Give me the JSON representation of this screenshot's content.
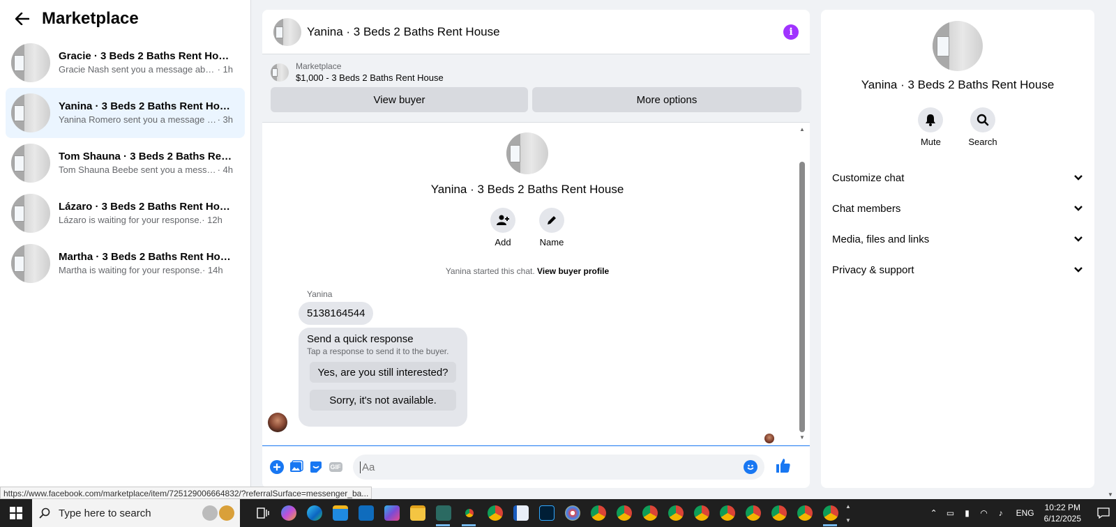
{
  "sidebar": {
    "title": "Marketplace",
    "conversations": [
      {
        "name": "Gracie · 3 Beds 2 Baths Rent House",
        "snippet": "Gracie Nash sent you a message abou...",
        "time": "· 1h",
        "active": false
      },
      {
        "name": "Yanina · 3 Beds 2 Baths Rent House",
        "snippet": "Yanina Romero sent you a message a...",
        "time": "· 3h",
        "active": true
      },
      {
        "name": "Tom Shauna · 3 Beds 2 Baths Rent ...",
        "snippet": "Tom Shauna Beebe sent you a messag...",
        "time": "· 4h",
        "active": false
      },
      {
        "name": "Lázaro · 3 Beds 2 Baths Rent House",
        "snippet": "Lázaro is waiting for your response.",
        "time": "· 12h",
        "active": false
      },
      {
        "name": "Martha · 3 Beds 2 Baths Rent House",
        "snippet": "Martha is waiting for your response.",
        "time": "· 14h",
        "active": false
      }
    ]
  },
  "chat": {
    "title": "Yanina · 3 Beds 2 Baths Rent House",
    "listing": {
      "label": "Marketplace",
      "price_title": "$1,000 - 3 Beds 2 Baths Rent House"
    },
    "view_buyer": "View buyer",
    "more_options": "More options",
    "profile_name": "Yanina · 3 Beds 2 Baths Rent House",
    "actions": {
      "add": "Add",
      "name": "Name"
    },
    "started_text": "Yanina started this chat.",
    "view_profile": "View buyer profile",
    "sender": "Yanina",
    "message": "5138164544",
    "quick": {
      "title": "Send a quick response",
      "subtitle": "Tap a response to send it to the buyer.",
      "options": [
        "Yes, are you still interested?",
        "Sorry, it's not available."
      ]
    },
    "composer_placeholder": "Aa",
    "gif_label": "GIF"
  },
  "panel": {
    "name": "Yanina · 3 Beds 2 Baths Rent House",
    "mute": "Mute",
    "search": "Search",
    "sections": [
      "Customize chat",
      "Chat members",
      "Media, files and links",
      "Privacy & support"
    ]
  },
  "status_url": "https://www.facebook.com/marketplace/item/725129006664832/?referralSurface=messenger_ba...",
  "taskbar": {
    "search_placeholder": "Type here to search",
    "language": "ENG",
    "time": "10:22 PM",
    "date": "6/12/2025"
  },
  "colors": {
    "accent": "#1877f2",
    "info": "#a033ff",
    "active_row": "#ebf5ff"
  }
}
